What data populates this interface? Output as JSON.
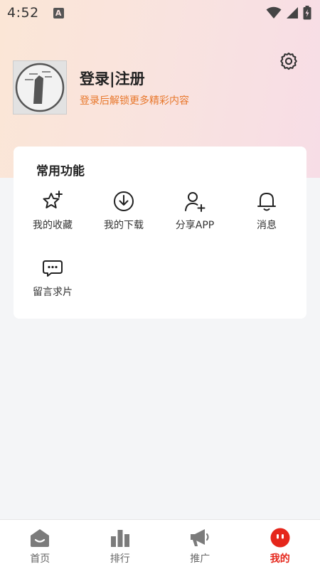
{
  "status": {
    "time": "4:52",
    "a_badge": "A"
  },
  "profile": {
    "title": "登录|注册",
    "subtitle": "登录后解锁更多精彩内容"
  },
  "functions": {
    "title": "常用功能",
    "items": [
      {
        "label": "我的收藏",
        "icon": "star-plus-icon"
      },
      {
        "label": "我的下载",
        "icon": "download-icon"
      },
      {
        "label": "分享APP",
        "icon": "add-user-icon"
      },
      {
        "label": "消息",
        "icon": "bell-icon"
      },
      {
        "label": "留言求片",
        "icon": "message-icon"
      }
    ]
  },
  "nav": {
    "items": [
      {
        "label": "首页",
        "icon": "home-icon"
      },
      {
        "label": "排行",
        "icon": "bar-chart-icon"
      },
      {
        "label": "推广",
        "icon": "megaphone-icon"
      },
      {
        "label": "我的",
        "icon": "face-icon",
        "active": true
      }
    ]
  },
  "colors": {
    "accent": "#e5261b",
    "subtitle_orange": "#e8772b",
    "hero_gradient_start": "#fbe6d6",
    "hero_gradient_end": "#f7dde6"
  }
}
